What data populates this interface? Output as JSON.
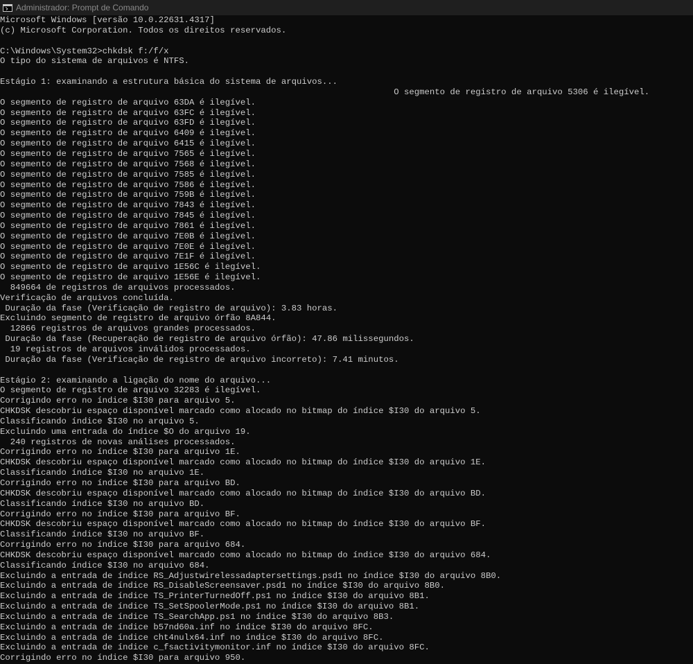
{
  "window": {
    "title": "Administrador: Prompt de Comando",
    "icon": "cmd-icon"
  },
  "console": {
    "lines": [
      "Microsoft Windows [versão 10.0.22631.4317]",
      "(c) Microsoft Corporation. Todos os direitos reservados.",
      "",
      "C:\\Windows\\System32>chkdsk f:/f/x",
      "O tipo do sistema de arquivos é NTFS.",
      "",
      "Estágio 1: examinando a estrutura básica do sistema de arquivos...",
      "                                                                             O segmento de registro de arquivo 5306 é ilegível.",
      "O segmento de registro de arquivo 63DA é ilegível.",
      "O segmento de registro de arquivo 63FC é ilegível.",
      "O segmento de registro de arquivo 63FD é ilegível.",
      "O segmento de registro de arquivo 6409 é ilegível.",
      "O segmento de registro de arquivo 6415 é ilegível.",
      "O segmento de registro de arquivo 7565 é ilegível.",
      "O segmento de registro de arquivo 7568 é ilegível.",
      "O segmento de registro de arquivo 7585 é ilegível.",
      "O segmento de registro de arquivo 7586 é ilegível.",
      "O segmento de registro de arquivo 759B é ilegível.",
      "O segmento de registro de arquivo 7843 é ilegível.",
      "O segmento de registro de arquivo 7845 é ilegível.",
      "O segmento de registro de arquivo 7861 é ilegível.",
      "O segmento de registro de arquivo 7E0B é ilegível.",
      "O segmento de registro de arquivo 7E0E é ilegível.",
      "O segmento de registro de arquivo 7E1F é ilegível.",
      "O segmento de registro de arquivo 1E56C é ilegível.",
      "O segmento de registro de arquivo 1E56E é ilegível.",
      "  849664 de registros de arquivos processados.",
      "Verificação de arquivos concluída.",
      " Duração da fase (Verificação de registro de arquivo): 3.83 horas.",
      "Excluindo segmento de registro de arquivo órfão 8A844.",
      "  12866 registros de arquivos grandes processados.",
      " Duração da fase (Recuperação de registro de arquivo órfão): 47.86 milissegundos.",
      "  19 registros de arquivos inválidos processados.",
      " Duração da fase (Verificação de registro de arquivo incorreto): 7.41 minutos.",
      "",
      "Estágio 2: examinando a ligação do nome do arquivo...",
      "O segmento de registro de arquivo 32283 é ilegível.",
      "Corrigindo erro no índice $I30 para arquivo 5.",
      "CHKDSK descobriu espaço disponível marcado como alocado no bitmap do índice $I30 do arquivo 5.",
      "Classificando índice $I30 no arquivo 5.",
      "Excluindo uma entrada do índice $O do arquivo 19.",
      "  240 registros de novas análises processados.",
      "Corrigindo erro no índice $I30 para arquivo 1E.",
      "CHKDSK descobriu espaço disponível marcado como alocado no bitmap do índice $I30 do arquivo 1E.",
      "Classificando índice $I30 no arquivo 1E.",
      "Corrigindo erro no índice $I30 para arquivo BD.",
      "CHKDSK descobriu espaço disponível marcado como alocado no bitmap do índice $I30 do arquivo BD.",
      "Classificando índice $I30 no arquivo BD.",
      "Corrigindo erro no índice $I30 para arquivo BF.",
      "CHKDSK descobriu espaço disponível marcado como alocado no bitmap do índice $I30 do arquivo BF.",
      "Classificando índice $I30 no arquivo BF.",
      "Corrigindo erro no índice $I30 para arquivo 684.",
      "CHKDSK descobriu espaço disponível marcado como alocado no bitmap do índice $I30 do arquivo 684.",
      "Classificando índice $I30 no arquivo 684.",
      "Excluindo a entrada de índice RS_Adjustwirelessadaptersettings.psd1 no índice $I30 do arquivo 8B0.",
      "Excluindo a entrada de índice RS_DisableScreensaver.psd1 no índice $I30 do arquivo 8B0.",
      "Excluindo a entrada de índice TS_PrinterTurnedOff.ps1 no índice $I30 do arquivo 8B1.",
      "Excluindo a entrada de índice TS_SetSpoolerMode.ps1 no índice $I30 do arquivo 8B1.",
      "Excluindo a entrada de índice TS_SearchApp.ps1 no índice $I30 do arquivo 8B3.",
      "Excluindo a entrada de índice b57nd60a.inf no índice $I30 do arquivo 8FC.",
      "Excluindo a entrada de índice cht4nulx64.inf no índice $I30 do arquivo 8FC.",
      "Excluindo a entrada de índice c_fsactivitymonitor.inf no índice $I30 do arquivo 8FC.",
      "Corrigindo erro no índice $I30 para arquivo 950."
    ]
  }
}
